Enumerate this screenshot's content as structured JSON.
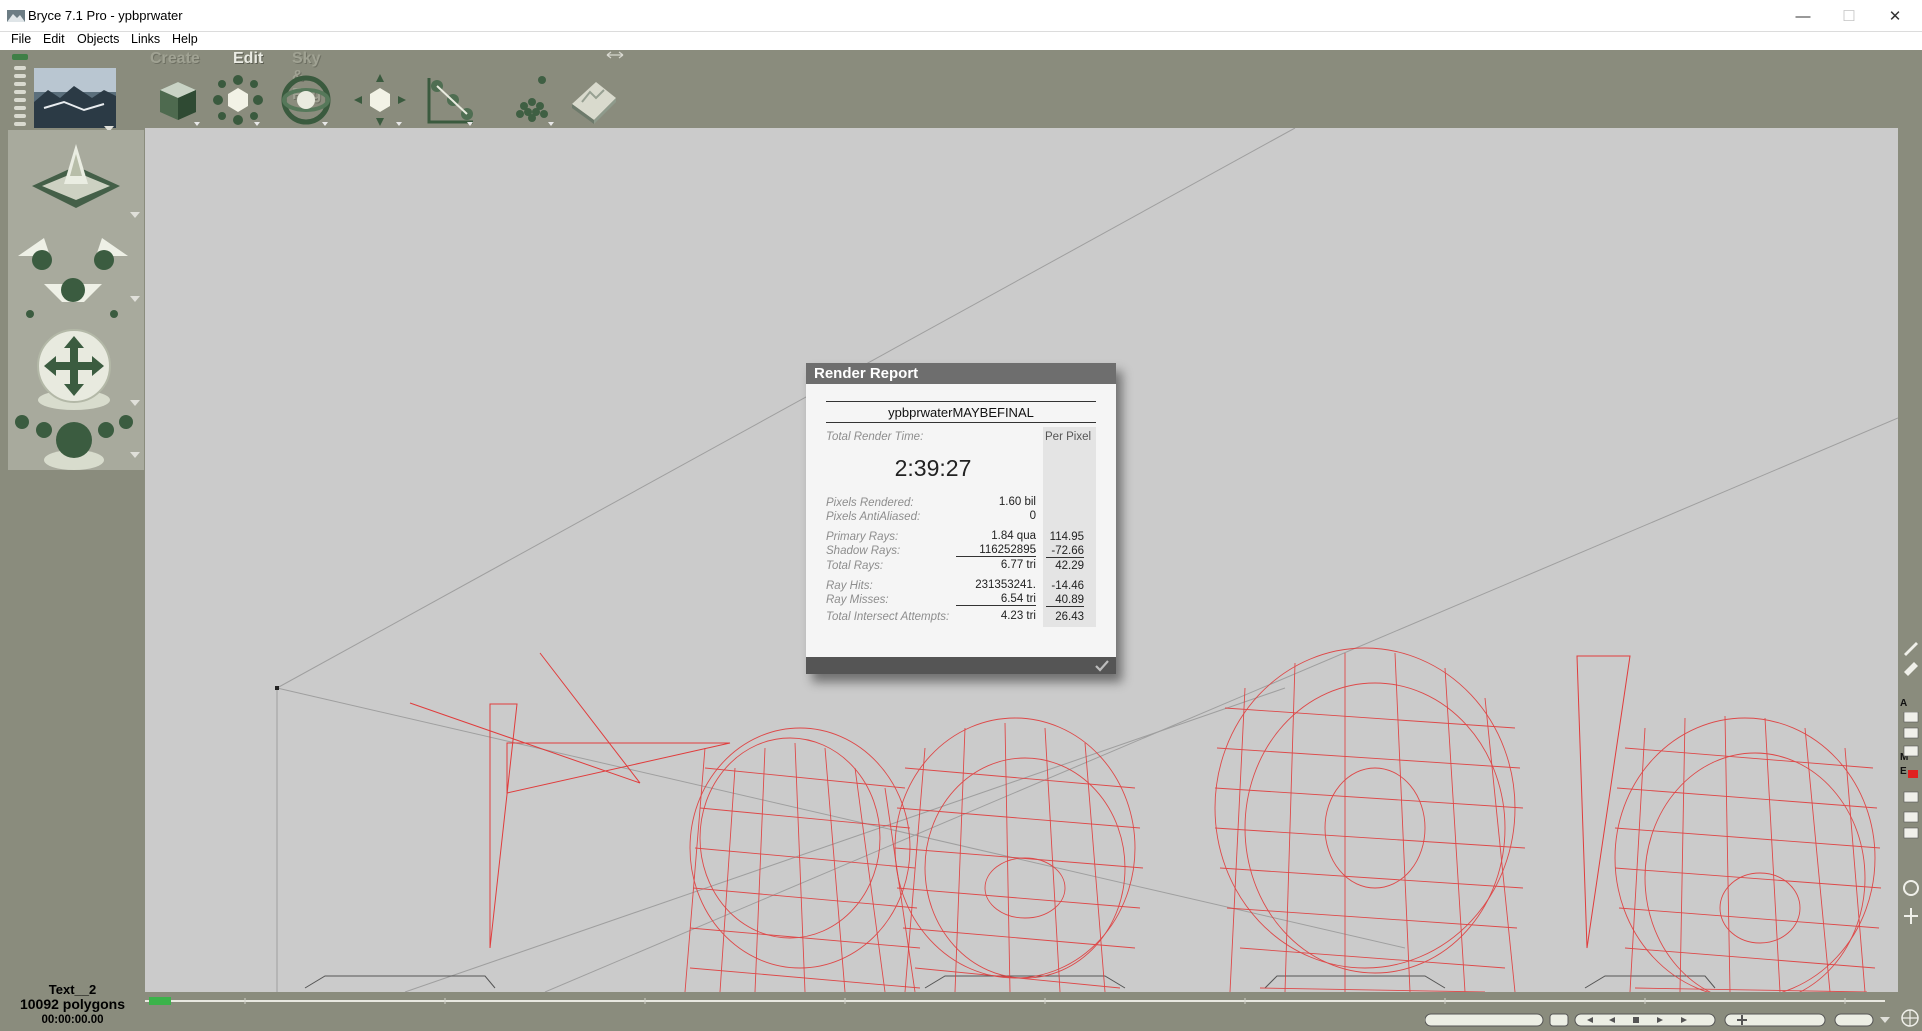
{
  "window": {
    "title": "Bryce 7.1  Pro - ypbprwater",
    "minimize": "—",
    "maximize": "☐",
    "close": "✕"
  },
  "menu": [
    "File",
    "Edit",
    "Objects",
    "Links",
    "Help"
  ],
  "palette_tabs": {
    "create": "Create",
    "edit": "Edit",
    "sky_fog": "Sky & Fog"
  },
  "status": {
    "object_name": "Text__2",
    "polygons": "10092 polygons",
    "timecode": "00:00:00.00"
  },
  "render_report": {
    "title": "Render Report",
    "scene_name": "ypbprwaterMAYBEFINAL",
    "total_render_time_label": "Total Render Time:",
    "per_pixel_label": "Per Pixel",
    "total_render_time": "2:39:27",
    "rows": [
      {
        "label": "Pixels Rendered:",
        "value": "1.60 bil",
        "per_pixel": ""
      },
      {
        "label": "Pixels AntiAliased:",
        "value": "0",
        "per_pixel": ""
      },
      {
        "label": "Primary Rays:",
        "value": "1.84 qua",
        "per_pixel": "114.95"
      },
      {
        "label": "Shadow Rays:",
        "value": "116252895̵",
        "per_pixel": "-72.66"
      },
      {
        "label": "Total Rays:",
        "value": "6.77 tri",
        "per_pixel": "42.29"
      },
      {
        "label": "Ray Hits:",
        "value": "231353241.",
        "per_pixel": "-14.46"
      },
      {
        "label": "Ray Misses:",
        "value": "6.54 tri",
        "per_pixel": "40.89"
      },
      {
        "label": "Total Intersect Attempts:",
        "value": "4.23 tri",
        "per_pixel": "26.43"
      }
    ],
    "ok_icon": "checkmark-icon"
  },
  "right_toolbar_letters": [
    "A",
    "M",
    "E"
  ],
  "colors": {
    "chrome": "#8a8c7d",
    "viewport": "#cbcbcb",
    "wireframe": "#e03c3c",
    "dialog_title": "#6e6e6e"
  }
}
